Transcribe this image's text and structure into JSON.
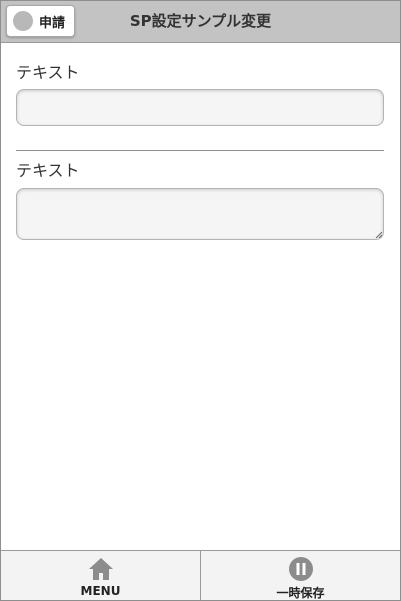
{
  "header": {
    "apply_button_label": "申請",
    "title": "SP設定サンプル変更"
  },
  "form": {
    "fields": [
      {
        "label": "テキスト",
        "value": ""
      },
      {
        "label": "テキスト",
        "value": ""
      }
    ]
  },
  "footer": {
    "menu_label": "MENU",
    "menu_icon": "home-icon",
    "save_label": "一時保存",
    "save_icon": "pause-icon"
  },
  "colors": {
    "header_bg": "#c3c3c3",
    "icon_gray": "#8c8c8c",
    "footer_bg": "#f3f3f3"
  }
}
